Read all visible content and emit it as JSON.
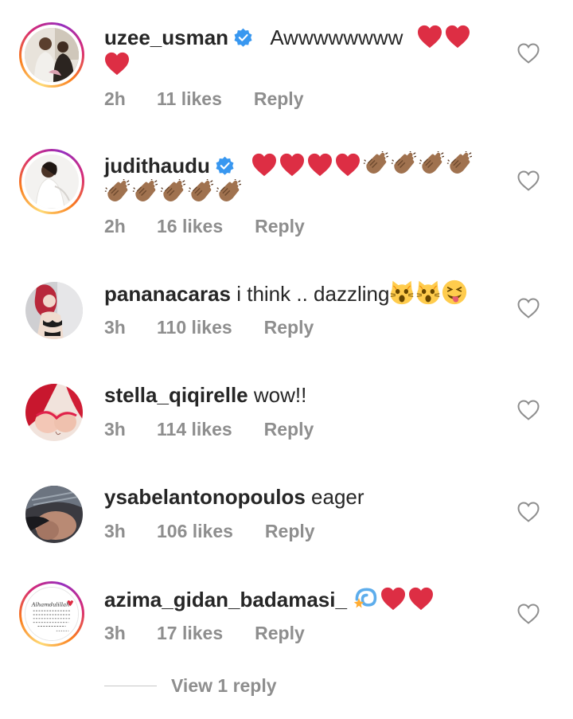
{
  "comments": [
    {
      "username": "uzee_usman",
      "verified": true,
      "text": "Awwwwwwww",
      "emojis": [
        "red-heart",
        "red-heart",
        "red-heart"
      ],
      "time": "2h",
      "likes": "11 likes",
      "reply_label": "Reply",
      "has_story_ring": true
    },
    {
      "username": "judithaudu",
      "verified": true,
      "text": "",
      "emojis": [
        "red-heart",
        "red-heart",
        "red-heart",
        "red-heart",
        "clapping-hands",
        "clapping-hands",
        "clapping-hands",
        "clapping-hands",
        "clapping-hands",
        "clapping-hands",
        "clapping-hands",
        "clapping-hands",
        "clapping-hands"
      ],
      "time": "2h",
      "likes": "16 likes",
      "reply_label": "Reply",
      "has_story_ring": true
    },
    {
      "username": "pananacaras",
      "verified": false,
      "text": "i think .. dazzling",
      "emojis": [
        "weary-cat",
        "weary-cat",
        "squinting-tongue-face"
      ],
      "time": "3h",
      "likes": "110 likes",
      "reply_label": "Reply",
      "has_story_ring": false
    },
    {
      "username": "stella_qiqirelle",
      "verified": false,
      "text": "wow!!",
      "emojis": [],
      "time": "3h",
      "likes": "114 likes",
      "reply_label": "Reply",
      "has_story_ring": false
    },
    {
      "username": "ysabelantonopoulos",
      "verified": false,
      "text": "eager",
      "emojis": [],
      "time": "3h",
      "likes": "106 likes",
      "reply_label": "Reply",
      "has_story_ring": false
    },
    {
      "username": "azima_gidan_badamasi_",
      "verified": false,
      "text": "",
      "emojis": [
        "dizzy",
        "red-heart",
        "red-heart"
      ],
      "time": "3h",
      "likes": "17 likes",
      "reply_label": "Reply",
      "has_story_ring": true
    }
  ],
  "view_replies": "View 1 reply",
  "avatar_text": "Alhamdulillah",
  "colors": {
    "username": "#262626",
    "meta": "#8e8e8e",
    "verified": "#3897f0",
    "heart_emoji": "#dd2e44",
    "clap_emoji": "#a0724f"
  },
  "icons": {
    "like_button": "heart-outline-icon",
    "verified": "verified-badge-icon"
  }
}
